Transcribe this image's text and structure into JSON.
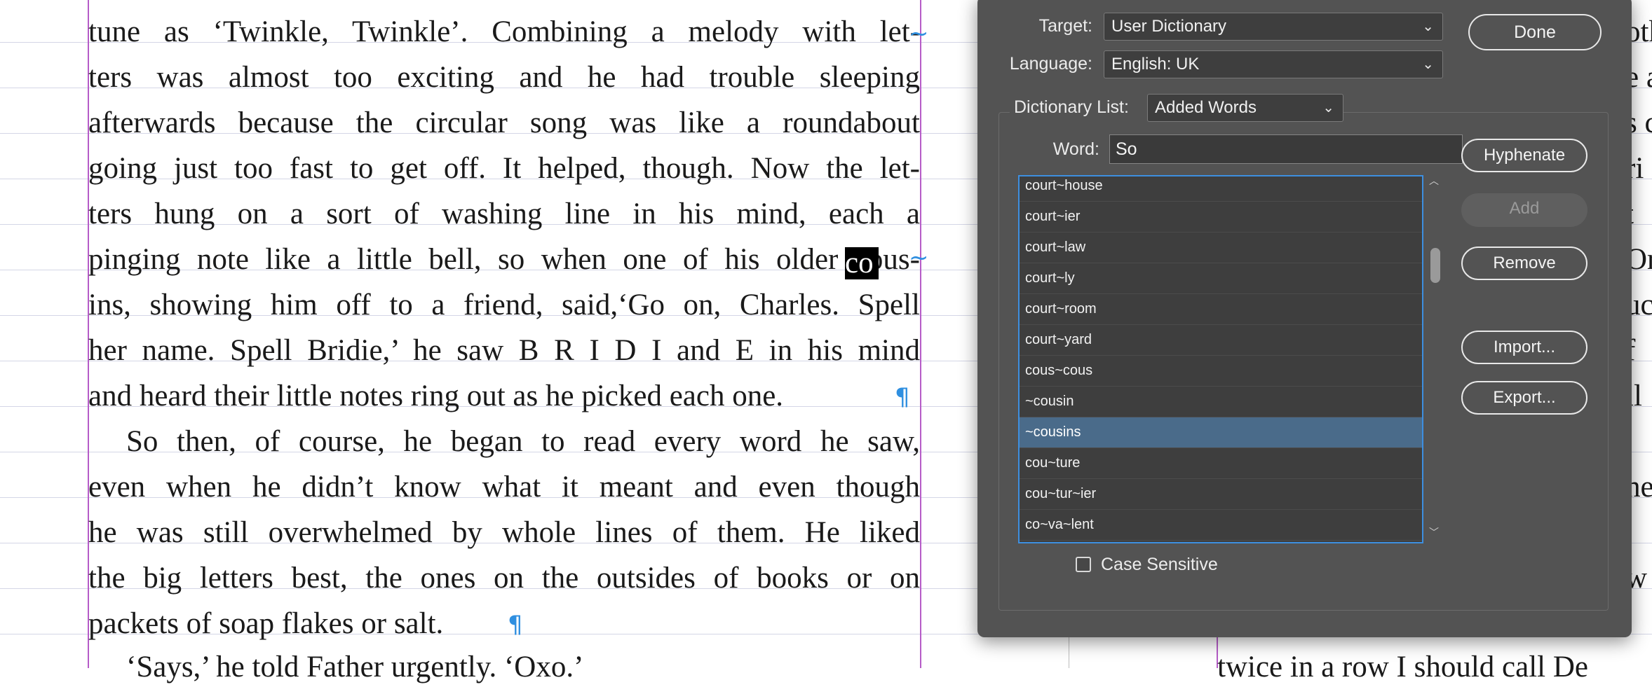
{
  "document": {
    "left_lines": [
      "tune as ‘Twinkle, Twinkle’. Combining a melody with let-",
      "ters was almost too exciting and he had trouble sleeping",
      "afterwards because the circular song was like a roundabout",
      "going just too fast to get off. It helped, though. Now the let-",
      "ters hung on a sort of washing line in his mind, each a",
      "pinging note like a little bell, so when one of his older cous-",
      "ins, showing him off to a friend, said,‘Go on, Charles. Spell",
      "her name. Spell Bridie,’ he saw B R I D I and E in his mind",
      "and heard their little notes ring out as he picked each one.",
      "So then, of course, he began to read every word he saw,",
      "even when he didn’t know what it meant and even though",
      "he was still overwhelmed by whole lines of them. He liked",
      "the big letters best, the ones on the outsides of books or on",
      "packets of soap flakes or salt.",
      "‘Says,’ he told Father urgently. ‘Oxo.’"
    ],
    "selected_text": "co",
    "pilcrow": "¶",
    "hyphen_mark": "~",
    "right_fragments": [
      "oth",
      "e a",
      "s c",
      "ri",
      "t",
      "Or",
      "uc",
      "f",
      "ll",
      "he",
      "w"
    ],
    "right_bottom_line": "twice in a row I should call De"
  },
  "dialog": {
    "target_label": "Target:",
    "target_value": "User Dictionary",
    "language_label": "Language:",
    "language_value": "English: UK",
    "dictionary_list_label": "Dictionary List:",
    "dictionary_list_value": "Added Words",
    "word_label": "Word:",
    "word_value": "So",
    "buttons": {
      "done": "Done",
      "hyphenate": "Hyphenate",
      "add": "Add",
      "remove": "Remove",
      "import": "Import...",
      "export": "Export..."
    },
    "list_items": [
      "court~house",
      "court~ier",
      "court~law",
      "court~ly",
      "court~room",
      "court~yard",
      "cous~cous",
      "~cousin",
      "~cousins",
      "cou~ture",
      "cou~tur~ier",
      "co~va~lent"
    ],
    "selected_item": "~cousins",
    "case_sensitive_label": "Case Sensitive",
    "case_sensitive_checked": false,
    "chevron_icon": "chevron-down-icon"
  },
  "colors": {
    "dialog_bg": "#535353",
    "list_selection": "#4a6b8a",
    "focus_ring": "#3d8fe0",
    "invisibles": "#2f8fe0",
    "margin_guide": "#b65cc8"
  }
}
